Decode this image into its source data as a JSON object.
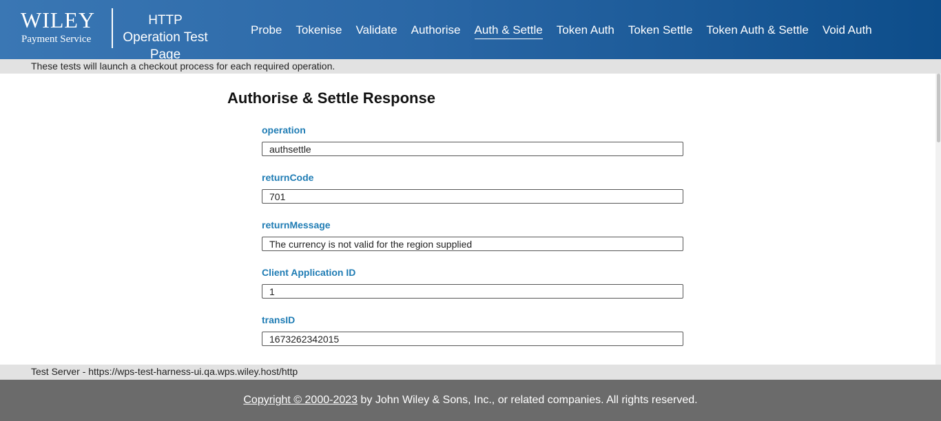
{
  "header": {
    "logo_text": "WILEY",
    "logo_subtitle": "Payment Service",
    "title": "HTTP Operation Test Page",
    "nav": [
      {
        "label": "Probe",
        "active": false
      },
      {
        "label": "Tokenise",
        "active": false
      },
      {
        "label": "Validate",
        "active": false
      },
      {
        "label": "Authorise",
        "active": false
      },
      {
        "label": "Auth & Settle",
        "active": true
      },
      {
        "label": "Token Auth",
        "active": false
      },
      {
        "label": "Token Settle",
        "active": false
      },
      {
        "label": "Token Auth & Settle",
        "active": false
      },
      {
        "label": "Void Auth",
        "active": false
      }
    ]
  },
  "info_bar": {
    "text": "These tests will launch a checkout process for each required operation."
  },
  "main": {
    "heading": "Authorise & Settle Response",
    "fields": [
      {
        "label": "operation",
        "value": "authsettle"
      },
      {
        "label": "returnCode",
        "value": "701"
      },
      {
        "label": "returnMessage",
        "value": "The currency is not valid for the region supplied"
      },
      {
        "label": "Client Application ID",
        "value": "1"
      },
      {
        "label": "transID",
        "value": "1673262342015"
      }
    ]
  },
  "footer": {
    "server_text": "Test Server - https://wps-test-harness-ui.qa.wps.wiley.host/http",
    "copyright_link": "Copyright © 2000-2023",
    "copyright_rest": " by John Wiley & Sons, Inc., or related companies. All rights reserved."
  },
  "colors": {
    "header_start": "#3a77b4",
    "header_end": "#0d4d8a",
    "label_blue": "#1f7cb4",
    "footer_gray": "#6b6b6b"
  }
}
